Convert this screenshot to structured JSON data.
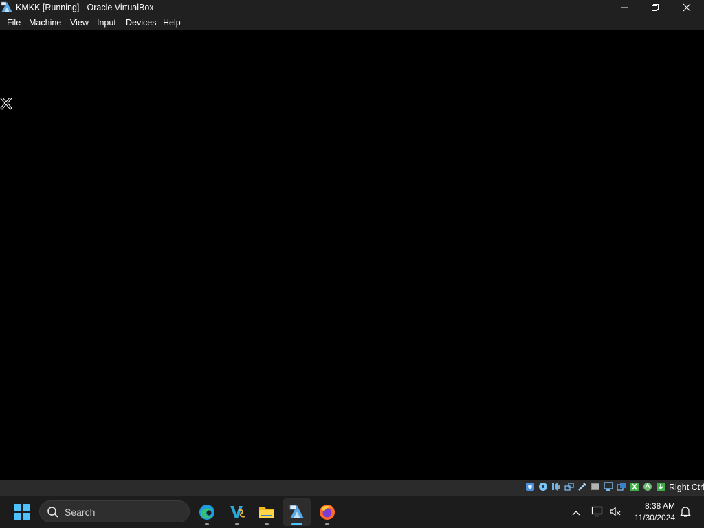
{
  "window": {
    "title": "KMKK [Running] - Oracle VirtualBox",
    "controls": [
      "minimize",
      "restore",
      "close"
    ]
  },
  "menubar": {
    "items": [
      "File",
      "Machine",
      "View",
      "Input",
      "Devices",
      "Help"
    ]
  },
  "vm_screen": {
    "background": "#000000",
    "content": "blank"
  },
  "statusbar": {
    "icons": [
      "hard-disk-icon",
      "optical-drive-icon",
      "audio-icon",
      "network-icon",
      "usb-icon",
      "shared-folders-icon",
      "display-icon",
      "recording-icon",
      "virtualization-icon",
      "mouse-integration-icon",
      "keyboard-capture-icon"
    ],
    "host_key": "Right Ctrl"
  },
  "taskbar": {
    "search_label": "Search",
    "apps": [
      "edge-icon",
      "visual-studio-icon",
      "file-explorer-icon",
      "virtualbox-icon",
      "firefox-icon"
    ],
    "active_app": "virtualbox-icon",
    "clock": {
      "time": "8:38 AM",
      "date": "11/30/2024"
    }
  },
  "colors": {
    "titlebar": "#202020",
    "taskbar": "#1c1c1c",
    "accent": "#4cc2ff"
  }
}
